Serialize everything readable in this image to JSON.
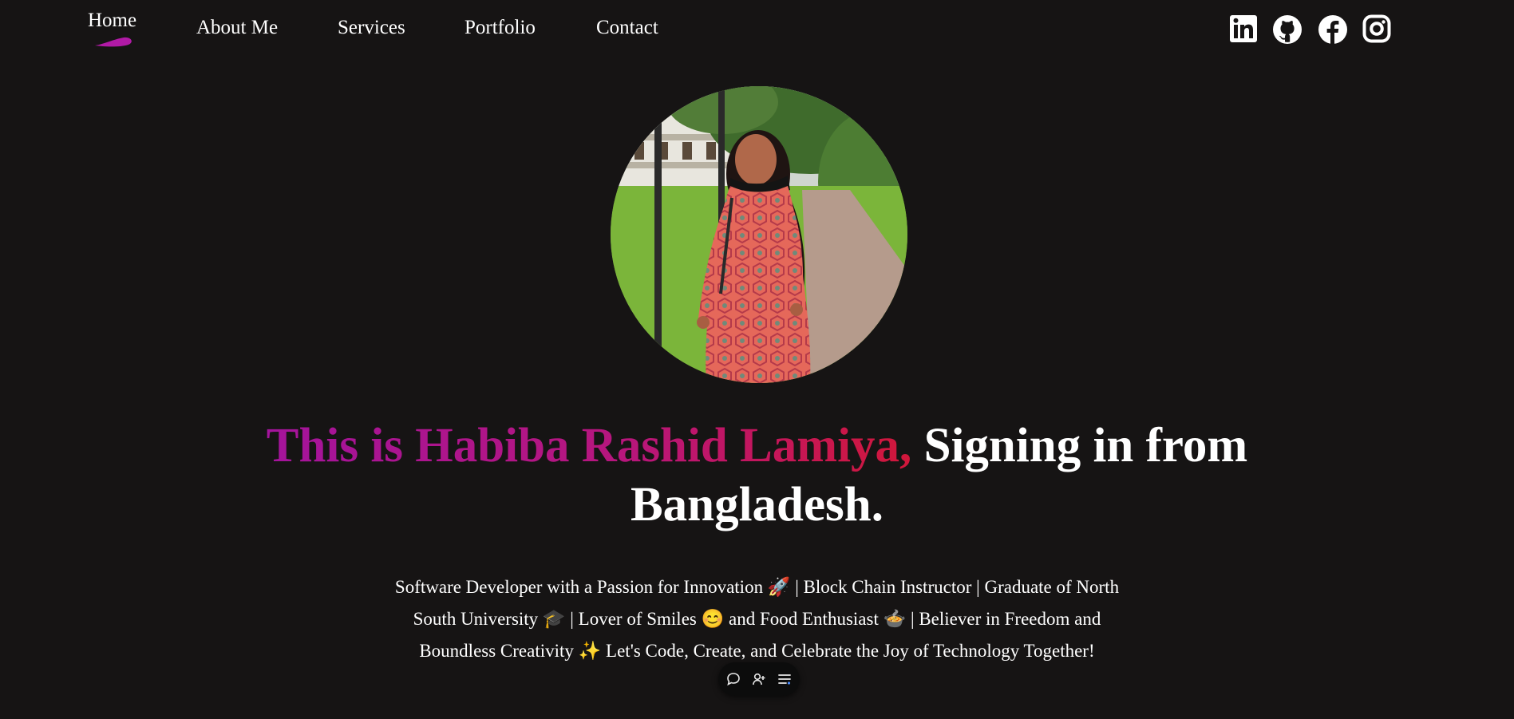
{
  "nav": {
    "home": "Home",
    "about": "About Me",
    "services": "Services",
    "portfolio": "Portfolio",
    "contact": "Contact",
    "active_item": "Home",
    "accent_color": "#b11aa6"
  },
  "social": {
    "icons": [
      "linkedin-icon",
      "github-icon",
      "facebook-icon",
      "instagram-icon"
    ]
  },
  "hero": {
    "headline_gradient": "This is Habiba Rashid Lamiya,",
    "headline_rest": "Signing in from Bangladesh.",
    "gradient_colors": [
      "#a4149c",
      "#d1173a"
    ],
    "bio": "Software Developer with a Passion for Innovation 🚀 | Block Chain Instructor | Graduate of North South University 🎓 | Lover of Smiles 😊 and Food Enthusiast 🍲 | Believer in Freedom and Boundless Creativity ✨ Let's Code, Create, and Celebrate the Joy of Technology Together!"
  },
  "toolbar": {
    "icons": [
      "comment-icon",
      "user-add-icon",
      "list-icon"
    ]
  }
}
